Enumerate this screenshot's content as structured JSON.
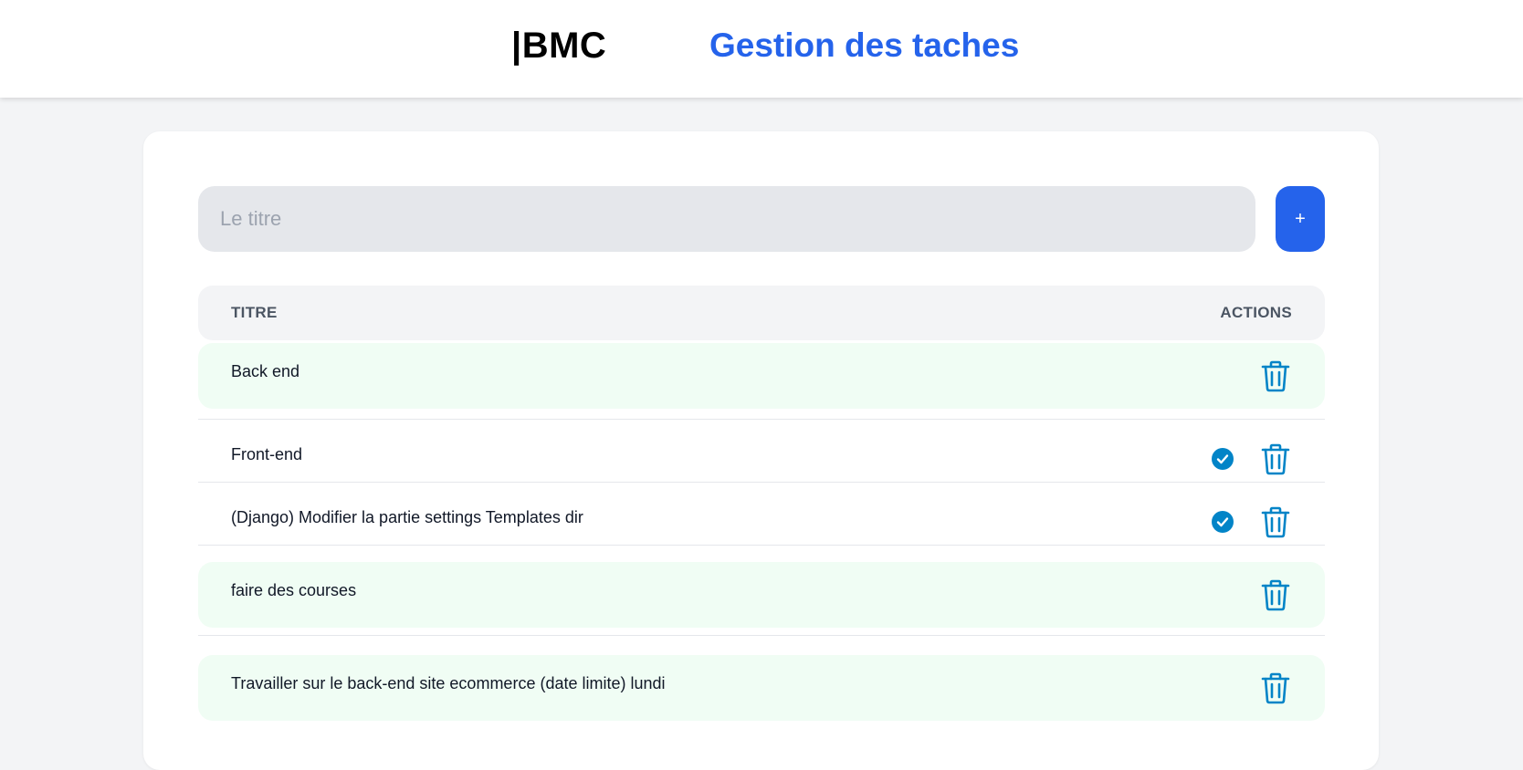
{
  "header": {
    "brand": "|BMC",
    "title": "Gestion des taches"
  },
  "form": {
    "title_placeholder": "Le titre",
    "title_value": "",
    "add_label": "+"
  },
  "table": {
    "columns": [
      "TITRE",
      "ACTIONS"
    ],
    "tasks": [
      {
        "title": "Back end",
        "completed": true
      },
      {
        "title": "Front-end",
        "completed": false
      },
      {
        "title": "(Django) Modifier la partie settings Templates dir",
        "completed": false
      },
      {
        "title": "faire des courses",
        "completed": true
      },
      {
        "title": "Travailler sur le back-end site ecommerce (date limite) lundi",
        "completed": true
      }
    ]
  },
  "icons": {
    "complete": "check-circle-icon",
    "delete": "trash-icon"
  },
  "colors": {
    "accent": "#2563eb",
    "action_icon": "#0284c7",
    "done_row": "#f0fdf4"
  }
}
